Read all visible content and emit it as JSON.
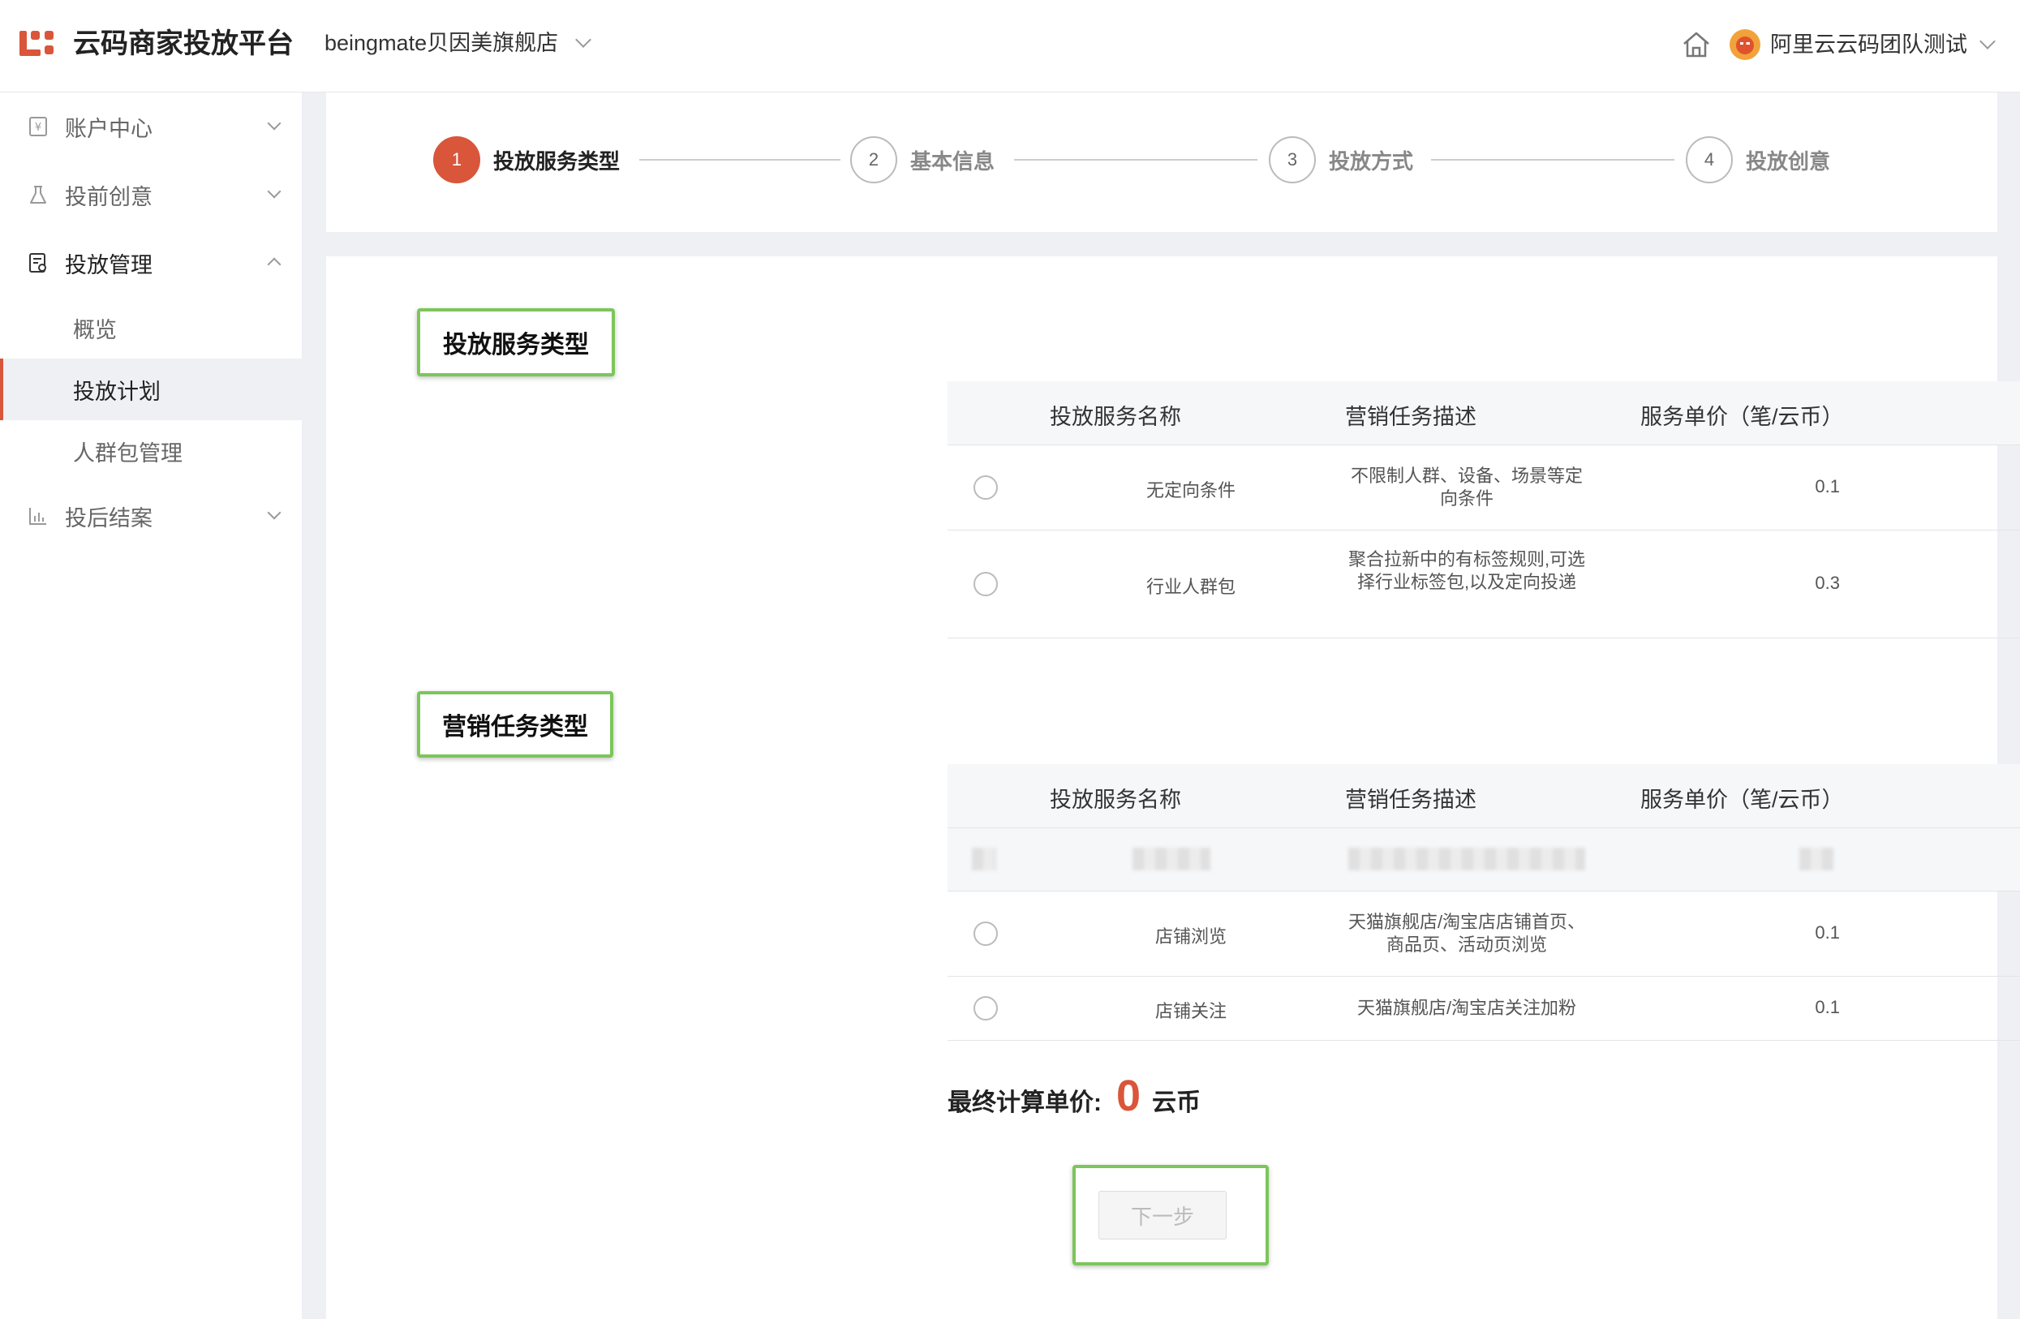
{
  "header": {
    "brand": "云码商家投放平台",
    "shop_name": "beingmate贝因美旗舰店",
    "user_name": "阿里云云码团队测试",
    "accent_color": "#d9563a"
  },
  "sidebar": {
    "items": [
      {
        "label": "账户中心",
        "icon": "account-icon"
      },
      {
        "label": "投前创意",
        "icon": "flask-icon"
      },
      {
        "label": "投放管理",
        "icon": "document-icon"
      },
      {
        "label": "投后结案",
        "icon": "bar-chart-icon"
      }
    ],
    "sub_items": [
      {
        "label": "概览"
      },
      {
        "label": "投放计划"
      },
      {
        "label": "人群包管理"
      }
    ]
  },
  "steps": [
    {
      "num": "1",
      "label": "投放服务类型"
    },
    {
      "num": "2",
      "label": "基本信息"
    },
    {
      "num": "3",
      "label": "投放方式"
    },
    {
      "num": "4",
      "label": "投放创意"
    }
  ],
  "service_section": {
    "title": "投放服务类型",
    "columns": [
      "投放服务名称",
      "营销任务描述",
      "服务单价（笔/云币）"
    ],
    "rows": [
      {
        "name": "无定向条件",
        "desc": "不限制人群、设备、场景等定向条件",
        "price": "0.1"
      },
      {
        "name": "行业人群包",
        "desc": "聚合拉新中的有标签规则,可选择行业标签包,以及定向投递",
        "price": "0.3"
      }
    ]
  },
  "task_section": {
    "title": "营销任务类型",
    "columns": [
      "投放服务名称",
      "营销任务描述",
      "服务单价（笔/云币）"
    ],
    "rows": [
      {
        "name": "店铺浏览",
        "desc": "天猫旗舰店/淘宝店店铺首页、商品页、活动页浏览",
        "price": "0.1"
      },
      {
        "name": "店铺关注",
        "desc": "天猫旗舰店/淘宝店关注加粉",
        "price": "0.1"
      }
    ]
  },
  "final": {
    "label": "最终计算单价:",
    "value": "0",
    "unit": "云币"
  },
  "next_button": "下一步"
}
